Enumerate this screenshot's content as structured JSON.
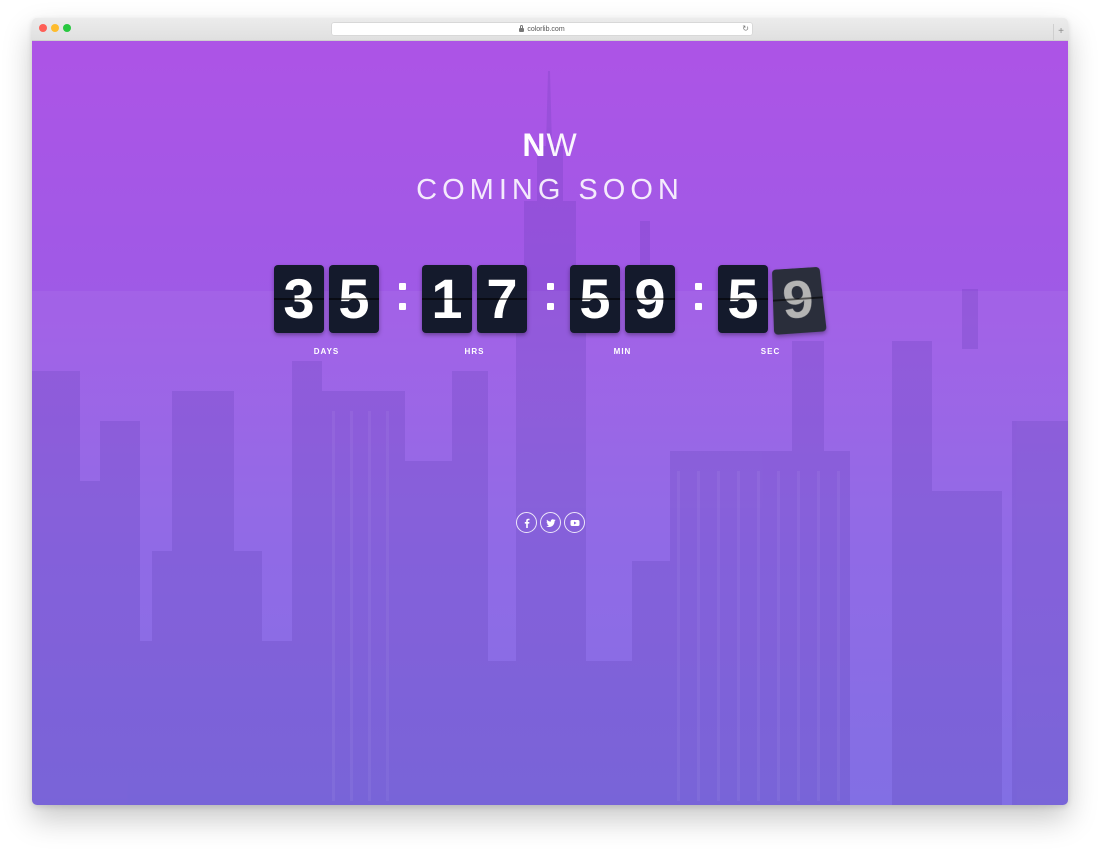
{
  "browser": {
    "url": "colorlib.com"
  },
  "brand": {
    "bold": "N",
    "light": "W"
  },
  "tagline": "COMING SOON",
  "countdown": {
    "units": [
      {
        "digits": [
          "3",
          "5"
        ],
        "label": "DAYS"
      },
      {
        "digits": [
          "1",
          "7"
        ],
        "label": "HRS"
      },
      {
        "digits": [
          "5",
          "9"
        ],
        "label": "MIN"
      },
      {
        "digits": [
          "5",
          "9"
        ],
        "label": "SEC"
      }
    ]
  },
  "social": [
    {
      "icon": "facebook-icon"
    },
    {
      "icon": "twitter-icon"
    },
    {
      "icon": "youtube-icon"
    }
  ],
  "colors": {
    "gradient_top": "#ad54e6",
    "gradient_bottom": "#7c68e3",
    "flip_card": "#141a2c",
    "text": "#ffffff"
  }
}
